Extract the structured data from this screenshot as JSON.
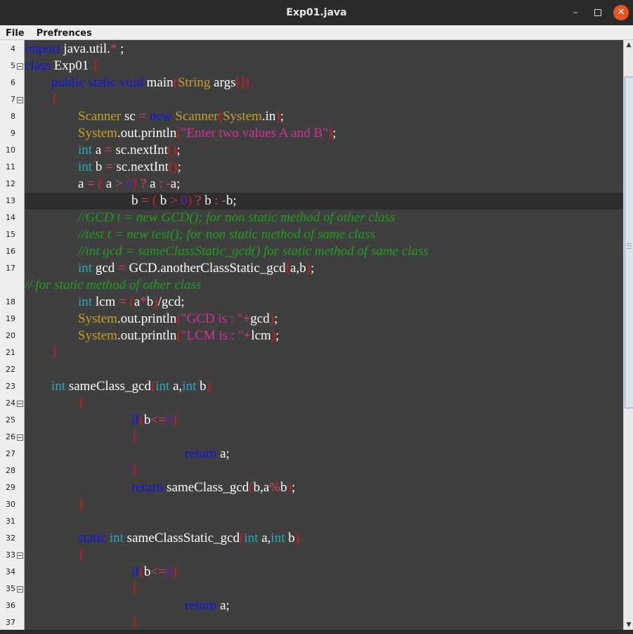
{
  "window": {
    "title": "Exp01.java",
    "minimize": "–",
    "close": "✕",
    "icons": {
      "minimize": "minimize-icon",
      "maximize": "maximize-icon",
      "close": "close-icon"
    }
  },
  "menu": [
    {
      "label": "File"
    },
    {
      "label": "Prefrences"
    }
  ],
  "colors": {
    "keyword": "#1111ee",
    "type": "#2aa8b8",
    "class": "#c8a02a",
    "string": "#d4309c",
    "punctuation": "#e01818",
    "number": "#6a1fb0",
    "comment": "#1ea01e",
    "background": "#3f3f3f"
  },
  "editor": {
    "current_line": 13,
    "lines": [
      {
        "n": "4",
        "fold": false,
        "tokens": [
          [
            "kw",
            "import"
          ],
          [
            "p",
            " java.util."
          ],
          [
            "op",
            "*"
          ],
          [
            "p",
            " ;"
          ]
        ]
      },
      {
        "n": "5",
        "fold": true,
        "tokens": [
          [
            "kw",
            "class"
          ],
          [
            "p",
            " Exp01 "
          ],
          [
            "pu",
            "{"
          ]
        ]
      },
      {
        "n": "6",
        "fold": false,
        "tokens": [
          [
            "p",
            "        "
          ],
          [
            "kw",
            "public static void"
          ],
          [
            "p",
            " main"
          ],
          [
            "pu",
            "("
          ],
          [
            "cls",
            "String"
          ],
          [
            "p",
            " args"
          ],
          [
            "pu",
            "[])"
          ]
        ]
      },
      {
        "n": "7",
        "fold": true,
        "tokens": [
          [
            "p",
            "        "
          ],
          [
            "pu",
            "{"
          ]
        ]
      },
      {
        "n": "8",
        "fold": false,
        "tokens": [
          [
            "p",
            "                "
          ],
          [
            "cls",
            "Scanner"
          ],
          [
            "p",
            " sc "
          ],
          [
            "op",
            "="
          ],
          [
            "p",
            " "
          ],
          [
            "kw",
            "new"
          ],
          [
            "p",
            " "
          ],
          [
            "cls",
            "Scanner"
          ],
          [
            "pu",
            "("
          ],
          [
            "cls",
            "System"
          ],
          [
            "p",
            ".in"
          ],
          [
            "pu",
            ")"
          ],
          [
            "p",
            ";"
          ]
        ]
      },
      {
        "n": "9",
        "fold": false,
        "tokens": [
          [
            "p",
            "                "
          ],
          [
            "cls",
            "System"
          ],
          [
            "p",
            ".out.println"
          ],
          [
            "pu",
            "("
          ],
          [
            "str",
            "\"Enter two values A and B\""
          ],
          [
            "pu",
            ")"
          ],
          [
            "p",
            ";"
          ]
        ]
      },
      {
        "n": "10",
        "fold": false,
        "tokens": [
          [
            "p",
            "                "
          ],
          [
            "ty",
            "int"
          ],
          [
            "p",
            " a "
          ],
          [
            "op",
            "="
          ],
          [
            "p",
            " sc.nextInt"
          ],
          [
            "pu",
            "()"
          ],
          [
            "p",
            ";"
          ]
        ]
      },
      {
        "n": "11",
        "fold": false,
        "tokens": [
          [
            "p",
            "                "
          ],
          [
            "ty",
            "int"
          ],
          [
            "p",
            " b "
          ],
          [
            "op",
            "="
          ],
          [
            "p",
            " sc.nextInt"
          ],
          [
            "pu",
            "()"
          ],
          [
            "p",
            ";"
          ]
        ]
      },
      {
        "n": "12",
        "fold": false,
        "tokens": [
          [
            "p",
            "                a "
          ],
          [
            "op",
            "="
          ],
          [
            "p",
            " "
          ],
          [
            "pu",
            "("
          ],
          [
            "p",
            " a "
          ],
          [
            "op",
            ">"
          ],
          [
            "p",
            " "
          ],
          [
            "num",
            "0"
          ],
          [
            "pu",
            ")"
          ],
          [
            "p",
            " "
          ],
          [
            "op",
            "?"
          ],
          [
            "p",
            " a "
          ],
          [
            "op",
            ":"
          ],
          [
            "p",
            " "
          ],
          [
            "op",
            "-"
          ],
          [
            "p",
            "a;"
          ]
        ]
      },
      {
        "n": "13",
        "fold": false,
        "tokens": [
          [
            "p",
            "                                b "
          ],
          [
            "op",
            "="
          ],
          [
            "p",
            " "
          ],
          [
            "pu",
            "("
          ],
          [
            "p",
            " b "
          ],
          [
            "op",
            ">"
          ],
          [
            "p",
            " "
          ],
          [
            "num",
            "0"
          ],
          [
            "pu",
            ")"
          ],
          [
            "p",
            " "
          ],
          [
            "op",
            "?"
          ],
          [
            "p",
            " b "
          ],
          [
            "op",
            ":"
          ],
          [
            "p",
            " "
          ],
          [
            "op",
            "-"
          ],
          [
            "p",
            "b;"
          ]
        ]
      },
      {
        "n": "14",
        "fold": false,
        "tokens": [
          [
            "p",
            "                "
          ],
          [
            "cm",
            "//GCD t = new GCD(); for non static method of other class"
          ]
        ]
      },
      {
        "n": "15",
        "fold": false,
        "tokens": [
          [
            "p",
            "                "
          ],
          [
            "cm",
            "//test t = new test(); for non static method of same class"
          ]
        ]
      },
      {
        "n": "16",
        "fold": false,
        "tokens": [
          [
            "p",
            "                "
          ],
          [
            "cm",
            "//int gcd = sameClassStatic_gcd() for static method of same class"
          ]
        ]
      },
      {
        "n": "17",
        "fold": false,
        "tokens": [
          [
            "p",
            "                "
          ],
          [
            "ty",
            "int"
          ],
          [
            "p",
            " gcd "
          ],
          [
            "op",
            "="
          ],
          [
            "p",
            " GCD.anotherClassStatic_gcd"
          ],
          [
            "pu",
            "("
          ],
          [
            "p",
            "a,b"
          ],
          [
            "pu",
            ")"
          ],
          [
            "p",
            ";"
          ]
        ]
      },
      {
        "n": "",
        "fold": false,
        "tokens": [
          [
            "cm",
            "// for static method of other class"
          ]
        ]
      },
      {
        "n": "18",
        "fold": false,
        "tokens": [
          [
            "p",
            "                "
          ],
          [
            "ty",
            "int"
          ],
          [
            "p",
            " lcm "
          ],
          [
            "op",
            "="
          ],
          [
            "p",
            " "
          ],
          [
            "pu",
            "("
          ],
          [
            "p",
            "a"
          ],
          [
            "op",
            "*"
          ],
          [
            "p",
            "b"
          ],
          [
            "pu",
            ")"
          ],
          [
            "p",
            "/gcd;"
          ]
        ]
      },
      {
        "n": "19",
        "fold": false,
        "tokens": [
          [
            "p",
            "                "
          ],
          [
            "cls",
            "System"
          ],
          [
            "p",
            ".out.println"
          ],
          [
            "pu",
            "("
          ],
          [
            "str",
            "\"GCD is : \""
          ],
          [
            "op",
            "+"
          ],
          [
            "p",
            "gcd"
          ],
          [
            "pu",
            ")"
          ],
          [
            "p",
            ";"
          ]
        ]
      },
      {
        "n": "20",
        "fold": false,
        "tokens": [
          [
            "p",
            "                "
          ],
          [
            "cls",
            "System"
          ],
          [
            "p",
            ".out.println"
          ],
          [
            "pu",
            "("
          ],
          [
            "str",
            "\"LCM is : \""
          ],
          [
            "op",
            "+"
          ],
          [
            "p",
            "lcm"
          ],
          [
            "pu",
            ")"
          ],
          [
            "p",
            ";"
          ]
        ]
      },
      {
        "n": "21",
        "fold": false,
        "tokens": [
          [
            "p",
            "        "
          ],
          [
            "pu",
            "}"
          ]
        ]
      },
      {
        "n": "22",
        "fold": false,
        "tokens": []
      },
      {
        "n": "23",
        "fold": false,
        "tokens": [
          [
            "p",
            "        "
          ],
          [
            "ty",
            "int"
          ],
          [
            "p",
            " sameClass_gcd"
          ],
          [
            "pu",
            "("
          ],
          [
            "ty",
            "int"
          ],
          [
            "p",
            " a,"
          ],
          [
            "ty",
            "int"
          ],
          [
            "p",
            " b"
          ],
          [
            "pu",
            ")"
          ]
        ]
      },
      {
        "n": "24",
        "fold": true,
        "tokens": [
          [
            "p",
            "                "
          ],
          [
            "pu",
            "{"
          ]
        ]
      },
      {
        "n": "25",
        "fold": false,
        "tokens": [
          [
            "p",
            "                                "
          ],
          [
            "kw",
            "if"
          ],
          [
            "pu",
            "("
          ],
          [
            "p",
            "b"
          ],
          [
            "op",
            "<="
          ],
          [
            "num",
            "0"
          ],
          [
            "pu",
            ")"
          ]
        ]
      },
      {
        "n": "26",
        "fold": true,
        "tokens": [
          [
            "p",
            "                                "
          ],
          [
            "pu",
            "{"
          ]
        ]
      },
      {
        "n": "27",
        "fold": false,
        "tokens": [
          [
            "p",
            "                                                "
          ],
          [
            "kw",
            "return"
          ],
          [
            "p",
            " a;"
          ]
        ]
      },
      {
        "n": "28",
        "fold": false,
        "tokens": [
          [
            "p",
            "                                "
          ],
          [
            "pu",
            "}"
          ]
        ]
      },
      {
        "n": "29",
        "fold": false,
        "tokens": [
          [
            "p",
            "                                "
          ],
          [
            "kw",
            "return"
          ],
          [
            "p",
            " sameClass_gcd"
          ],
          [
            "pu",
            "("
          ],
          [
            "p",
            "b,a"
          ],
          [
            "op",
            "%"
          ],
          [
            "p",
            "b"
          ],
          [
            "pu",
            ")"
          ],
          [
            "p",
            ";"
          ]
        ]
      },
      {
        "n": "30",
        "fold": false,
        "tokens": [
          [
            "p",
            "                "
          ],
          [
            "pu",
            "}"
          ]
        ]
      },
      {
        "n": "31",
        "fold": false,
        "tokens": []
      },
      {
        "n": "32",
        "fold": false,
        "tokens": [
          [
            "p",
            "                "
          ],
          [
            "kw",
            "static"
          ],
          [
            "p",
            " "
          ],
          [
            "ty",
            "int"
          ],
          [
            "p",
            " sameClassStatic_gcd"
          ],
          [
            "pu",
            "("
          ],
          [
            "ty",
            "int"
          ],
          [
            "p",
            " a,"
          ],
          [
            "ty",
            "int"
          ],
          [
            "p",
            " b"
          ],
          [
            "pu",
            ")"
          ]
        ]
      },
      {
        "n": "33",
        "fold": true,
        "tokens": [
          [
            "p",
            "                "
          ],
          [
            "pu",
            "{"
          ]
        ]
      },
      {
        "n": "34",
        "fold": false,
        "tokens": [
          [
            "p",
            "                                "
          ],
          [
            "kw",
            "if"
          ],
          [
            "pu",
            "("
          ],
          [
            "p",
            "b"
          ],
          [
            "op",
            "<="
          ],
          [
            "num",
            "0"
          ],
          [
            "pu",
            ")"
          ]
        ]
      },
      {
        "n": "35",
        "fold": true,
        "tokens": [
          [
            "p",
            "                                "
          ],
          [
            "pu",
            "{"
          ]
        ]
      },
      {
        "n": "36",
        "fold": false,
        "tokens": [
          [
            "p",
            "                                                "
          ],
          [
            "kw",
            "return"
          ],
          [
            "p",
            " a;"
          ]
        ]
      },
      {
        "n": "37",
        "fold": false,
        "tokens": [
          [
            "p",
            "                                "
          ],
          [
            "pu",
            "}"
          ]
        ]
      }
    ]
  },
  "scrollbar": {
    "up_arrow": "▲",
    "down_arrow": "▼",
    "position_fraction": 0.0,
    "visible_fraction": 0.58
  }
}
